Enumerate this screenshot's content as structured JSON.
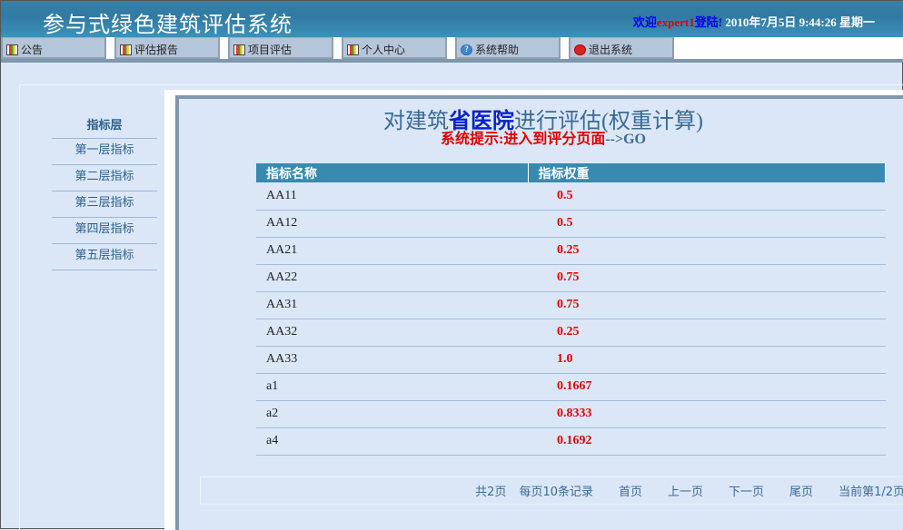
{
  "header": {
    "title": "参与式绿色建筑评估系统",
    "welcome_prefix": "欢迎",
    "user": "expert1",
    "welcome_suffix": "登陆!",
    "datetime": "2010年7月5日  9:44:26 星期一"
  },
  "nav": [
    {
      "label": "公告",
      "icon": "chart-icon"
    },
    {
      "label": "评估报告",
      "icon": "chart-icon"
    },
    {
      "label": "项目评估",
      "icon": "chart-icon"
    },
    {
      "label": "个人中心",
      "icon": "chart-icon"
    },
    {
      "label": "系统帮助",
      "icon": "help-icon"
    },
    {
      "label": "退出系统",
      "icon": "exit-icon"
    }
  ],
  "sidebar": {
    "title": "指标层",
    "items": [
      "第一层指标",
      "第二层指标",
      "第三层指标",
      "第四层指标",
      "第五层指标"
    ]
  },
  "main": {
    "title_prefix": "对建筑",
    "building": "省医院",
    "title_suffix": "进行评估(权重计算)",
    "hint": "系统提示:进入到评分页面",
    "hint_link": "-->GO"
  },
  "table": {
    "headers": [
      "指标名称",
      "指标权重"
    ],
    "rows": [
      [
        "AA11",
        "0.5"
      ],
      [
        "AA12",
        "0.5"
      ],
      [
        "AA21",
        "0.25"
      ],
      [
        "AA22",
        "0.75"
      ],
      [
        "AA31",
        "0.75"
      ],
      [
        "AA32",
        "0.25"
      ],
      [
        "AA33",
        "1.0"
      ],
      [
        "a1",
        "0.1667"
      ],
      [
        "a2",
        "0.8333"
      ],
      [
        "a4",
        "0.1692"
      ]
    ]
  },
  "pager": {
    "total": "共2页",
    "per_page": "每页10条记录",
    "first": "首页",
    "prev": "上一页",
    "next": "下一页",
    "last": "尾页",
    "current": "当前第1/2页"
  }
}
